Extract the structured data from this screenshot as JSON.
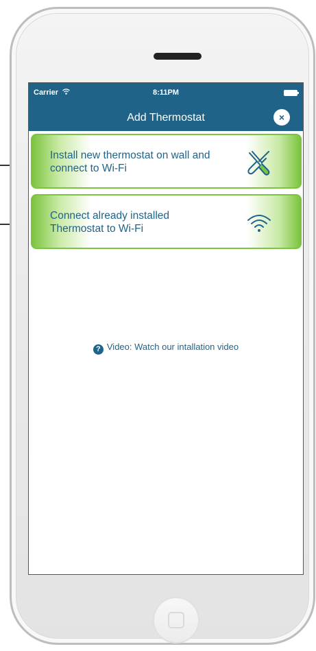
{
  "status_bar": {
    "carrier": "Carrier",
    "time": "8:11PM",
    "wifi_icon": "wifi-icon",
    "battery_icon": "battery-icon"
  },
  "header": {
    "title": "Add Thermostat",
    "close_icon": "close-icon",
    "close_symbol": "×",
    "background_color": "#1f6389"
  },
  "options": [
    {
      "label": "Install new thermostat on wall and connect to Wi-Fi",
      "icon": "tools-icon"
    },
    {
      "label": "Connect already installed Thermostat to Wi-Fi",
      "icon": "wifi-icon"
    }
  ],
  "video": {
    "icon": "help-icon",
    "icon_symbol": "?",
    "label": "Video: Watch our intallation video"
  },
  "colors": {
    "accent_green": "#7cc43f",
    "brand_blue": "#1f6389"
  }
}
